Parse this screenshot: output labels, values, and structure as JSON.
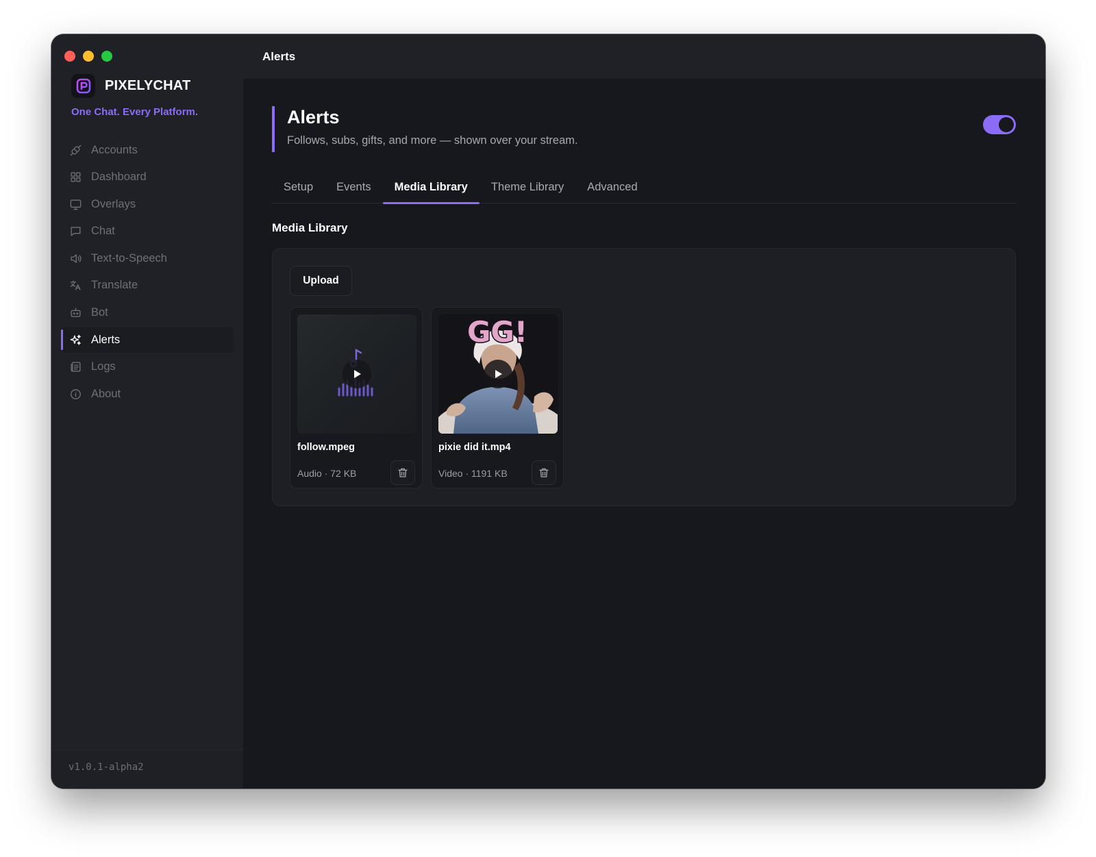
{
  "app": {
    "name": "PIXELYCHAT",
    "tagline": "One Chat. Every Platform.",
    "version": "v1.0.1-alpha2",
    "accent_color": "#8b6cf6"
  },
  "sidebar": {
    "items": [
      {
        "label": "Accounts",
        "icon": "plug-icon",
        "active": false
      },
      {
        "label": "Dashboard",
        "icon": "grid-icon",
        "active": false
      },
      {
        "label": "Overlays",
        "icon": "monitor-icon",
        "active": false
      },
      {
        "label": "Chat",
        "icon": "chat-bubble-icon",
        "active": false
      },
      {
        "label": "Text-to-Speech",
        "icon": "speaker-icon",
        "active": false
      },
      {
        "label": "Translate",
        "icon": "translate-icon",
        "active": false
      },
      {
        "label": "Bot",
        "icon": "bot-icon",
        "active": false
      },
      {
        "label": "Alerts",
        "icon": "sparkles-icon",
        "active": true
      },
      {
        "label": "Logs",
        "icon": "logs-icon",
        "active": false
      },
      {
        "label": "About",
        "icon": "info-icon",
        "active": false
      }
    ]
  },
  "topbar": {
    "title": "Alerts"
  },
  "header": {
    "title": "Alerts",
    "subtitle": "Follows, subs, gifts, and more — shown over your stream.",
    "enabled": true
  },
  "tabs": [
    {
      "label": "Setup",
      "active": false
    },
    {
      "label": "Events",
      "active": false
    },
    {
      "label": "Media Library",
      "active": true
    },
    {
      "label": "Theme Library",
      "active": false
    },
    {
      "label": "Advanced",
      "active": false
    }
  ],
  "media_library": {
    "title": "Media Library",
    "upload_label": "Upload",
    "items": [
      {
        "name": "follow.mpeg",
        "meta": "Audio · 72 KB",
        "kind": "audio"
      },
      {
        "name": "pixie did it.mp4",
        "meta": "Video · 1191 KB",
        "kind": "video",
        "thumb_text": "GG!"
      }
    ]
  }
}
